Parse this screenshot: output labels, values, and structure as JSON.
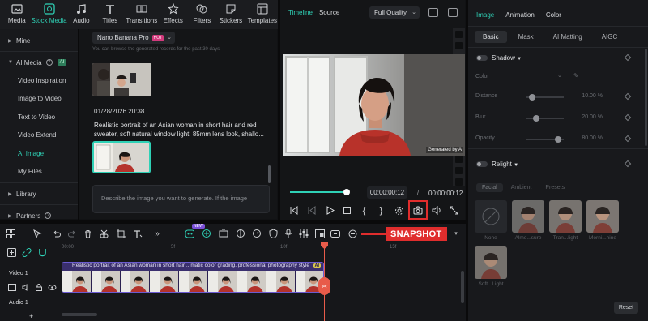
{
  "toolbar": {
    "items": [
      {
        "label": "Media",
        "icon": "media-icon"
      },
      {
        "label": "Stock Media",
        "icon": "stock-media-icon",
        "active": true
      },
      {
        "label": "Audio",
        "icon": "audio-icon"
      },
      {
        "label": "Titles",
        "icon": "titles-icon"
      },
      {
        "label": "Transitions",
        "icon": "transitions-icon"
      },
      {
        "label": "Effects",
        "icon": "effects-icon"
      },
      {
        "label": "Filters",
        "icon": "filters-icon"
      },
      {
        "label": "Stickers",
        "icon": "stickers-icon"
      },
      {
        "label": "Templates",
        "icon": "templates-icon"
      }
    ]
  },
  "sidebar": {
    "mine": "Mine",
    "ai_media": "AI Media",
    "ai_badge": "AI",
    "items": [
      "Video Inspiration",
      "Image to Video",
      "Text to Video",
      "Video Extend",
      "AI Image",
      "My Files"
    ],
    "active_item": "AI Image",
    "library": "Library",
    "partners": "Partners"
  },
  "media": {
    "model": "Nano Banana Pro",
    "hot_badge": "HOT",
    "hint": "You can browse the generated records for the past 30 days",
    "datetime": "01/28/2026 20:38",
    "prompt": "Realistic portrait of an Asian woman in short hair and red sweater, soft natural window light, 85mm lens look, shallo...",
    "input_placeholder": "Describe the image you want to generate. If the image"
  },
  "preview": {
    "tab_timeline": "Timeline",
    "tab_source": "Source",
    "quality": "Full Quality",
    "watermark": "Generated by A",
    "current_time": "00:00:00:12",
    "separator": "/",
    "total_time": "00:00:00:12",
    "progress": 1.0
  },
  "properties": {
    "tabs": [
      "Image",
      "Animation",
      "Color"
    ],
    "subtabs": [
      "Basic",
      "Mask",
      "AI Matting",
      "AIGC"
    ],
    "shadow": {
      "title": "Shadow",
      "color_label": "Color",
      "rows": [
        {
          "label": "Distance",
          "value": "10.00 %",
          "level": 0.1
        },
        {
          "label": "Blur",
          "value": "20.00 %",
          "level": 0.2
        },
        {
          "label": "Opacity",
          "value": "80.00 %",
          "level": 0.8
        }
      ]
    },
    "relight": {
      "title": "Relight",
      "tabs": [
        "Facial",
        "Ambient",
        "Presets"
      ],
      "presets": [
        "None",
        "Almo...sure",
        "Tran...light",
        "Morni...hine",
        "Soft...Light"
      ]
    },
    "reset": "Reset"
  },
  "timeline": {
    "annotation": "SNAPSHOT",
    "ruler": [
      "00:00",
      "5f",
      "10f",
      "15f"
    ],
    "tracks": [
      {
        "label": "Video 1"
      },
      {
        "label": "Audio 1"
      }
    ],
    "clip_title": "Realistic portrait of an Asian woman in short hair ...matic color grading, professional photography style",
    "clip_ai": "AI",
    "new_badge": "NEW"
  },
  "colors": {
    "accent": "#2fd1b6",
    "snapshot": "#e02d2d",
    "playhead": "#e85b4a",
    "clip": "#6a5bd0"
  }
}
